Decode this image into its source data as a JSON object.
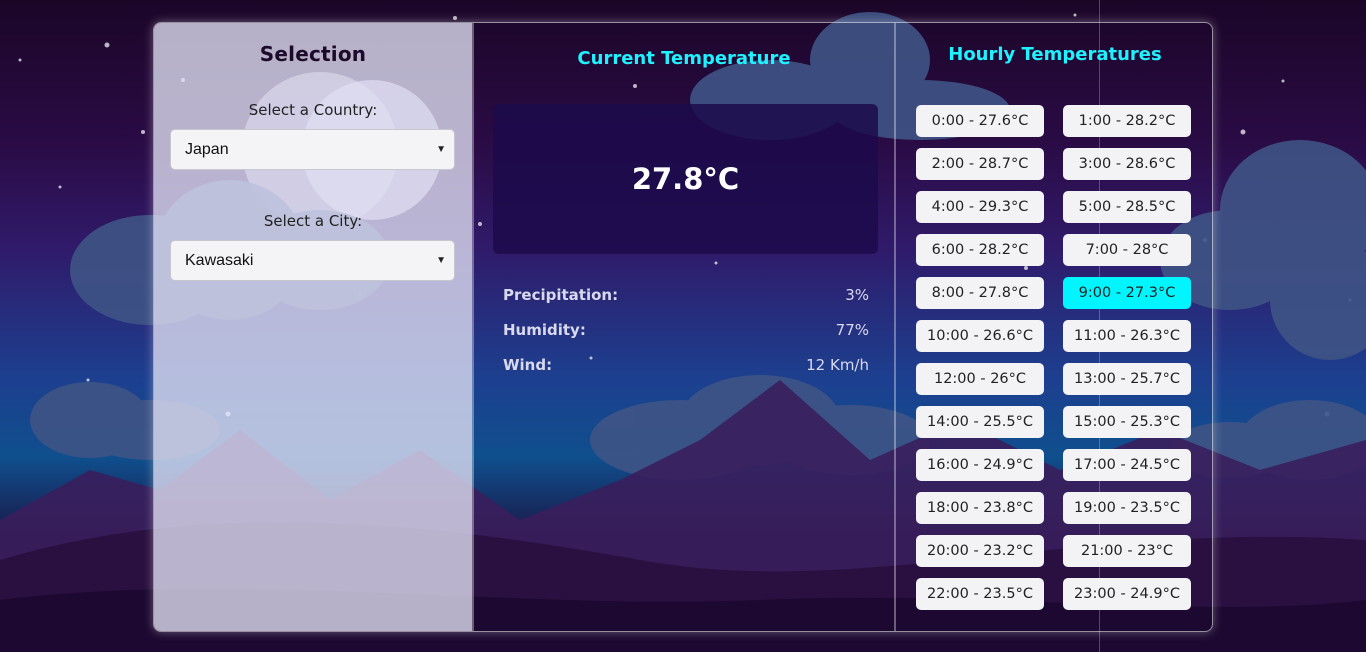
{
  "theme": {
    "accent": "#1ff2ff",
    "active_hour_bg": "#00f5ff",
    "panel_bg": "#1c0a4b"
  },
  "selection": {
    "title": "Selection",
    "country_label": "Select a Country:",
    "country_value": "Japan",
    "city_label": "Select a City:",
    "city_value": "Kawasaki",
    "dropdown_icon": "chevron-down-icon"
  },
  "current": {
    "title": "Current Temperature",
    "temperature": "27.8°C",
    "stats": [
      {
        "label": "Precipitation:",
        "value": "3%"
      },
      {
        "label": "Humidity:",
        "value": "77%"
      },
      {
        "label": "Wind:",
        "value": "12 Km/h"
      }
    ]
  },
  "hourly": {
    "title": "Hourly Temperatures",
    "active_index": 9,
    "items": [
      "0:00 - 27.6°C",
      "1:00 - 28.2°C",
      "2:00 - 28.7°C",
      "3:00 - 28.6°C",
      "4:00 - 29.3°C",
      "5:00 - 28.5°C",
      "6:00 - 28.2°C",
      "7:00 - 28°C",
      "8:00 - 27.8°C",
      "9:00 - 27.3°C",
      "10:00 - 26.6°C",
      "11:00 - 26.3°C",
      "12:00 - 26°C",
      "13:00 - 25.7°C",
      "14:00 - 25.5°C",
      "15:00 - 25.3°C",
      "16:00 - 24.9°C",
      "17:00 - 24.5°C",
      "18:00 - 23.8°C",
      "19:00 - 23.5°C",
      "20:00 - 23.2°C",
      "21:00 - 23°C",
      "22:00 - 23.5°C",
      "23:00 - 24.9°C"
    ]
  }
}
